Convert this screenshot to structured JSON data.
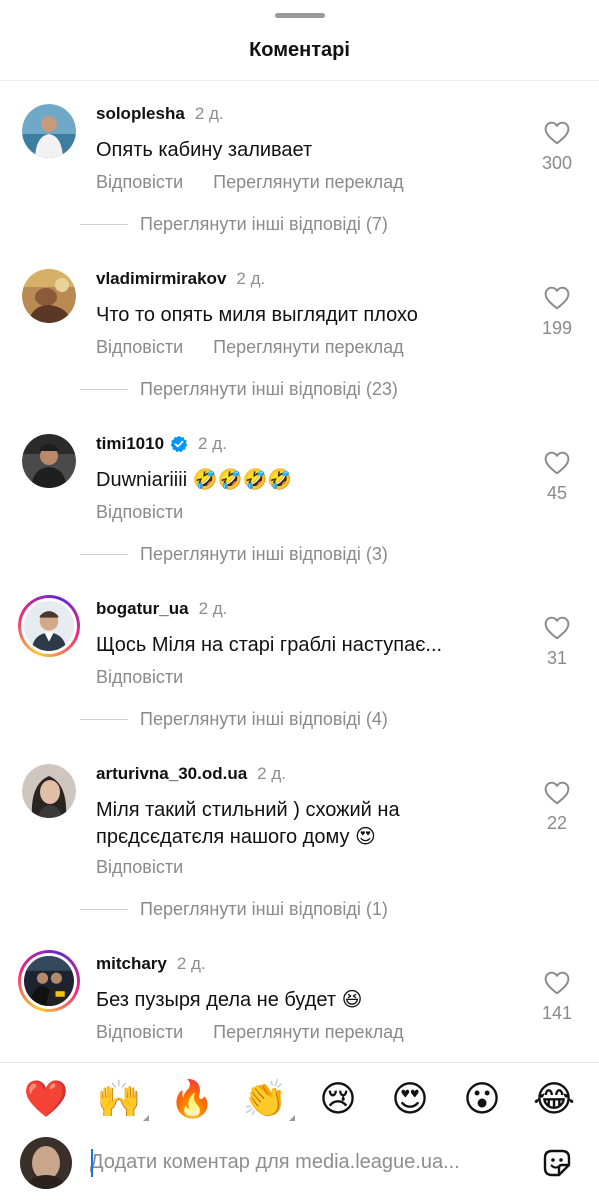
{
  "header": {
    "title": "Коментарі"
  },
  "comments": [
    {
      "username": "soloplesha",
      "time": "2 д.",
      "verified": false,
      "text": "Опять кабину заливает",
      "reply_label": "Відповісти",
      "translate_label": "Переглянути переклад",
      "likes": "300",
      "more_replies": "Переглянути інші відповіді (7)",
      "avatar_ring": false
    },
    {
      "username": "vladimirmirakov",
      "time": "2 д.",
      "verified": false,
      "text": "Что то опять миля выглядит плохо",
      "reply_label": "Відповісти",
      "translate_label": "Переглянути переклад",
      "likes": "199",
      "more_replies": "Переглянути інші відповіді (23)",
      "avatar_ring": false
    },
    {
      "username": "timi1010",
      "time": "2 д.",
      "verified": true,
      "text": "Duwniariiii 🤣🤣🤣🤣",
      "reply_label": "Відповісти",
      "likes": "45",
      "more_replies": "Переглянути інші відповіді (3)",
      "avatar_ring": false
    },
    {
      "username": "bogatur_ua",
      "time": "2 д.",
      "verified": false,
      "text": "Щось Міля на старі граблі наступає...",
      "reply_label": "Відповісти",
      "likes": "31",
      "more_replies": "Переглянути інші відповіді (4)",
      "avatar_ring": true
    },
    {
      "username": "arturivna_30.od.ua",
      "time": "2 д.",
      "verified": false,
      "text": "Міля такий стильний ) схожий на прєдсєдатєля нашого дому 😍",
      "reply_label": "Відповісти",
      "likes": "22",
      "more_replies": "Переглянути інші відповіді (1)",
      "avatar_ring": false
    },
    {
      "username": "mitchary",
      "time": "2 д.",
      "verified": false,
      "text": "Без пузыря дела не будет 😆",
      "reply_label": "Відповісти",
      "translate_label": "Переглянути переклад",
      "likes": "141",
      "avatar_ring": true
    }
  ],
  "quick_reactions": [
    "❤️",
    "🙌",
    "🔥",
    "👏",
    "😢",
    "😍",
    "😮",
    "😂"
  ],
  "composer": {
    "placeholder": "Додати коментар для media.league.ua..."
  },
  "icons": {
    "like": "heart-outline-icon",
    "verified": "verified-badge-icon",
    "sticker": "sticker-icon"
  },
  "colors": {
    "verified_blue": "#0095f6",
    "muted_text": "#8a8a8a"
  }
}
